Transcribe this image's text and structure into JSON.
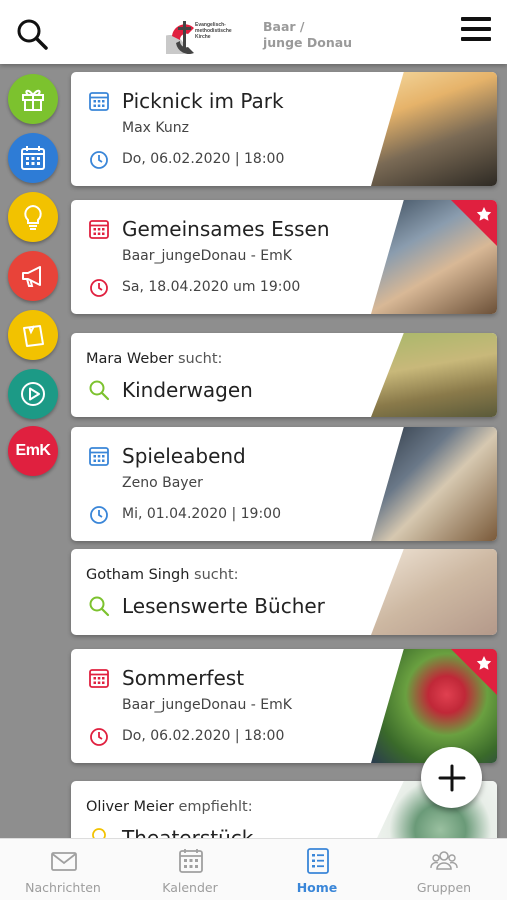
{
  "header": {
    "logo_small": "Evangelisch-methodistische Kirche",
    "group_line1": "Baar /",
    "group_line2": "junge Donau"
  },
  "rail": [
    {
      "name": "gift",
      "color": "#7cc22e"
    },
    {
      "name": "calendar",
      "color": "#2e7cd6"
    },
    {
      "name": "lightbulb",
      "color": "#f2c200"
    },
    {
      "name": "megaphone",
      "color": "#e84339"
    },
    {
      "name": "note",
      "color": "#f2c200"
    },
    {
      "name": "play",
      "color": "#1c9a86"
    },
    {
      "name": "emk",
      "color": "#e0203f",
      "label": "EmK"
    }
  ],
  "cards": [
    {
      "type": "event",
      "title": "Picknick im Park",
      "subtitle": "Max Kunz",
      "date": "Do, 06.02.2020 | 18:00",
      "accent": "#3a86d8",
      "featured": false
    },
    {
      "type": "event",
      "title": "Gemeinsames Essen",
      "subtitle": "Baar_jungeDonau - EmK",
      "date": "Sa, 18.04.2020 um 19:00",
      "accent": "#e0203f",
      "featured": true
    },
    {
      "type": "search",
      "person": "Mara Weber",
      "verb": "sucht:",
      "item": "Kinderwagen"
    },
    {
      "type": "event",
      "title": "Spieleabend",
      "subtitle": "Zeno Bayer",
      "date": "Mi, 01.04.2020 | 19:00",
      "accent": "#3a86d8",
      "featured": false
    },
    {
      "type": "search",
      "person": "Gotham Singh",
      "verb": "sucht:",
      "item": "Lesenswerte Bücher"
    },
    {
      "type": "event",
      "title": "Sommerfest",
      "subtitle": "Baar_jungeDonau - EmK",
      "date": "Do, 06.02.2020 | 18:00",
      "accent": "#e0203f",
      "featured": true
    },
    {
      "type": "recommend",
      "person": "Oliver Meier",
      "verb": "empfiehlt:",
      "item": "Theaterstück"
    }
  ],
  "nav": [
    {
      "label": "Nachrichten",
      "icon": "mail-icon",
      "active": false
    },
    {
      "label": "Kalender",
      "icon": "calendar-icon",
      "active": false
    },
    {
      "label": "Home",
      "icon": "home-list-icon",
      "active": true
    },
    {
      "label": "Gruppen",
      "icon": "people-icon",
      "active": false
    }
  ],
  "colors": {
    "active": "#3a86d8",
    "search_green": "#7cc22e",
    "emk_red": "#e0203f"
  }
}
